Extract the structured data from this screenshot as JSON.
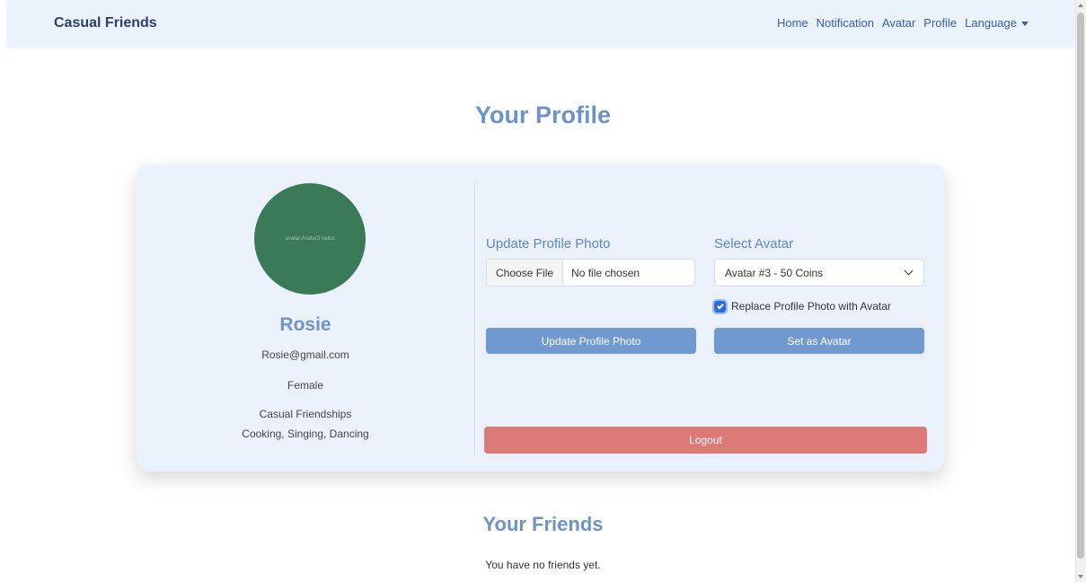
{
  "navbar": {
    "brand": "Casual Friends",
    "links": [
      "Home",
      "Notification",
      "Avatar",
      "Profile"
    ],
    "language_label": "Language"
  },
  "page": {
    "title": "Your Profile"
  },
  "profile": {
    "avatar_alt": "avatar Avatar3 natus",
    "avatar_color": "#3b7a58",
    "name": "Rosie",
    "email": "Rosie@gmail.com",
    "gender": "Female",
    "looking_for": "Casual Friendships",
    "interests": "Cooking, Singing, Dancing"
  },
  "update_photo": {
    "title": "Update Profile Photo",
    "choose_file_label": "Choose File",
    "file_status": "No file chosen",
    "button_label": "Update Profile Photo"
  },
  "select_avatar": {
    "title": "Select Avatar",
    "selected_option": "Avatar #3 - 50 Coins",
    "checkbox_label": "Replace Profile Photo with Avatar",
    "checkbox_checked": true,
    "button_label": "Set as Avatar"
  },
  "logout": {
    "label": "Logout"
  },
  "friends": {
    "title": "Your Friends",
    "empty_message": "You have no friends yet."
  },
  "colors": {
    "accent": "#6e93c9",
    "button_blue": "#7099d1",
    "button_red": "#dc7a77",
    "card_bg": "#eaf1fb"
  }
}
